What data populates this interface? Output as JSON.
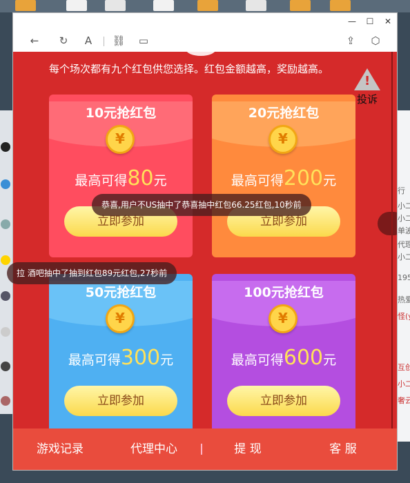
{
  "window": {
    "minimize_glyph": "—",
    "maximize_glyph": "☐",
    "close_glyph": "✕"
  },
  "toolbar": {
    "back_glyph": "←",
    "refresh_glyph": "↻",
    "font_glyph": "A",
    "link_glyph": "⛓",
    "tab_glyph": "▭",
    "share_glyph": "⇪",
    "box_glyph": "⬡"
  },
  "page": {
    "intro": "每个场次都有九个红包供您选择。红包金额越高，奖励越高。",
    "report_label": "投诉",
    "report_mark": "!"
  },
  "cards": [
    {
      "title": "10元抢红包",
      "prefix": "最高可得",
      "amount": "80",
      "unit": "元",
      "button": "立即参加",
      "coin": "¥"
    },
    {
      "title": "20元抢红包",
      "prefix": "最高可得",
      "amount": "200",
      "unit": "元",
      "button": "立即参加",
      "coin": "¥"
    },
    {
      "title": "50元抢红包",
      "prefix": "最高可得",
      "amount": "300",
      "unit": "元",
      "button": "立即参加",
      "coin": "¥"
    },
    {
      "title": "100元抢红包",
      "prefix": "最高可得",
      "amount": "600",
      "unit": "元",
      "button": "立即参加",
      "coin": "¥"
    }
  ],
  "toasts": [
    "恭喜,用户不US抽中了恭喜抽中红包66.25红包,10秒前",
    "拉 酒吧抽中了抽到红包89元红包,27秒前"
  ],
  "bottom_nav": {
    "records": "游戏记录",
    "agent": "代理中心",
    "withdraw": "提 现",
    "service": "客 服"
  },
  "right_fragments": [
    "行",
    "小二",
    "小二",
    "单波",
    "代理",
    "小二",
    "195",
    "热爱",
    "怪(y",
    "互创",
    "小二",
    "奢云"
  ],
  "colors": {
    "page_bg": "#d52a2a",
    "card_red": "#ff4d5f",
    "card_orange": "#ff8a3d",
    "card_blue": "#4fb0f2",
    "card_purple": "#b44ee0",
    "accent_yellow": "#ffe15a"
  }
}
